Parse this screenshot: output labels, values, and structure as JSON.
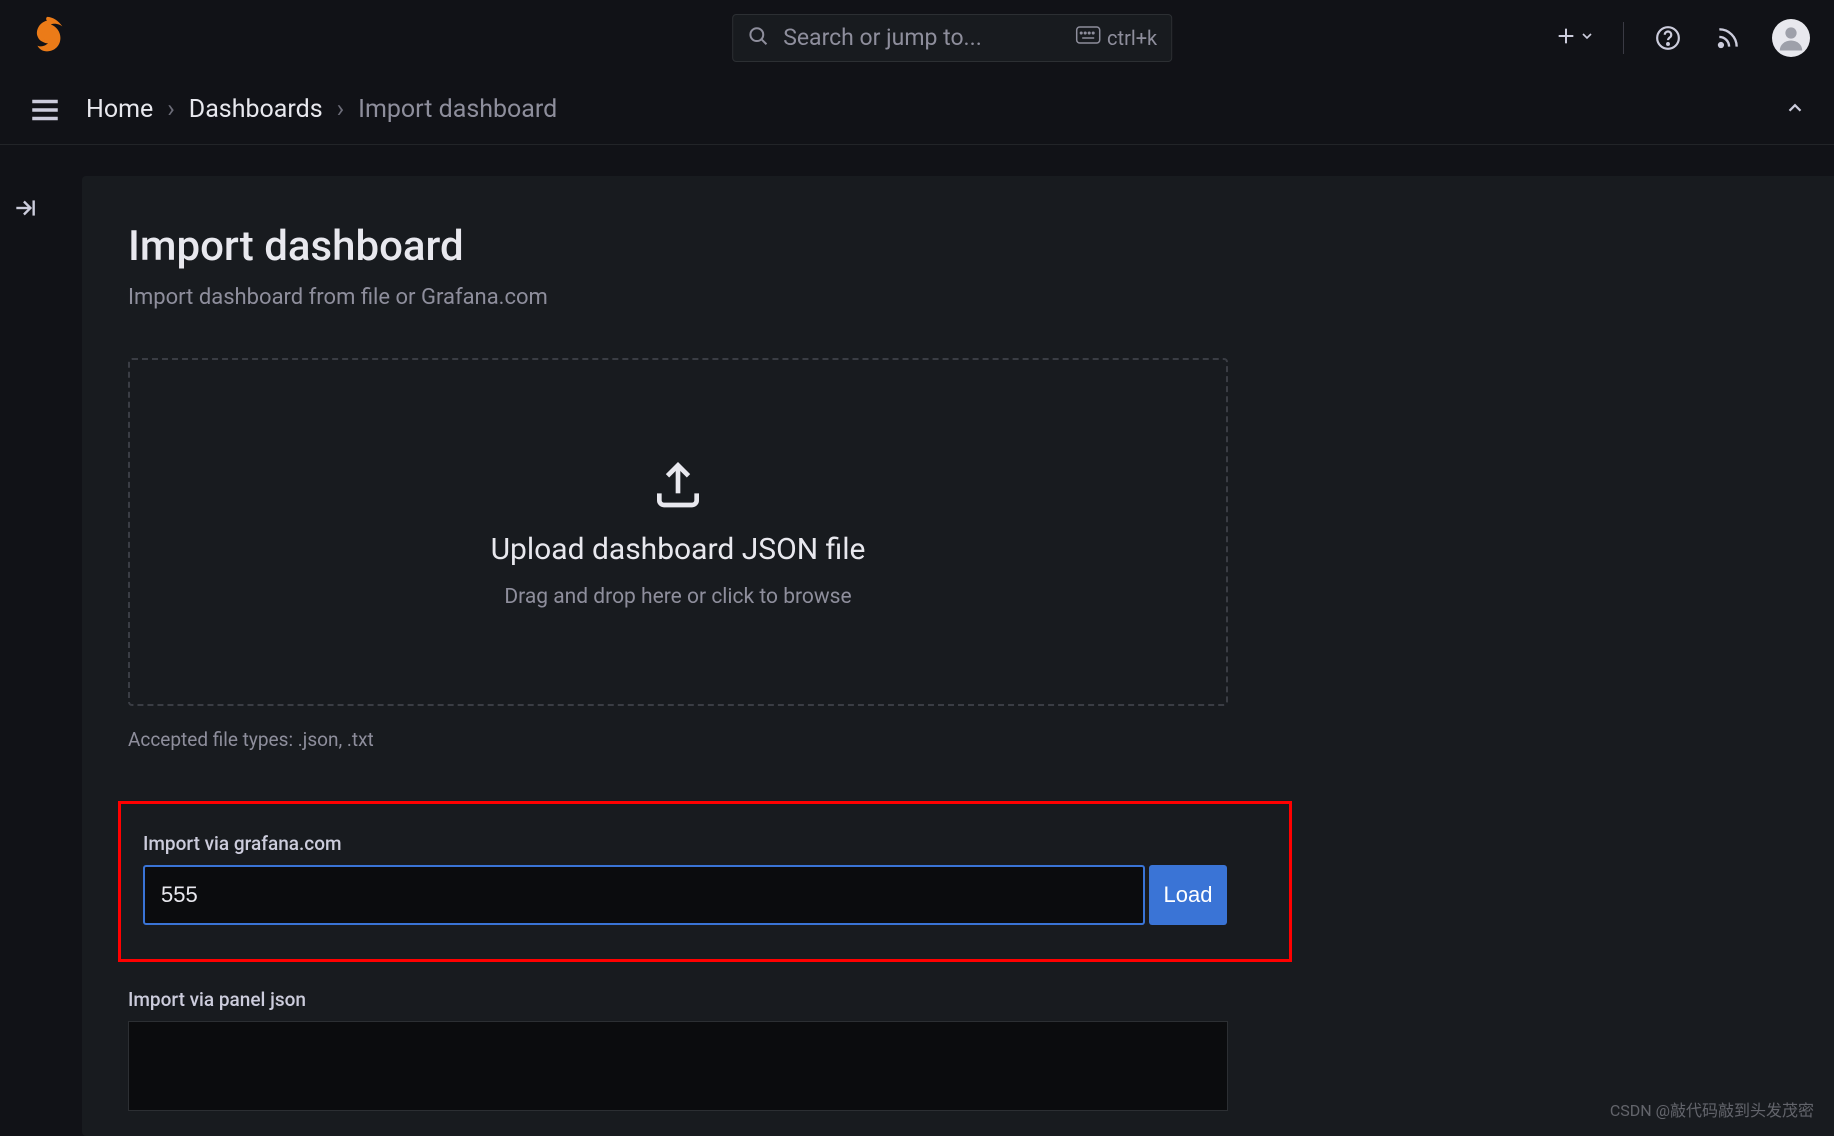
{
  "header": {
    "search_placeholder": "Search or jump to...",
    "kbd_hint": "ctrl+k"
  },
  "breadcrumb": {
    "home": "Home",
    "dashboards": "Dashboards",
    "current": "Import dashboard"
  },
  "page": {
    "title": "Import dashboard",
    "subtitle": "Import dashboard from file or Grafana.com"
  },
  "upload": {
    "title": "Upload dashboard JSON file",
    "hint": "Drag and drop here or click to browse",
    "accepted": "Accepted file types: .json, .txt"
  },
  "import_grafana": {
    "label": "Import via grafana.com",
    "value": "555",
    "load_label": "Load"
  },
  "import_panel": {
    "label": "Import via panel json"
  },
  "watermark": "CSDN @敲代码敲到头发茂密"
}
